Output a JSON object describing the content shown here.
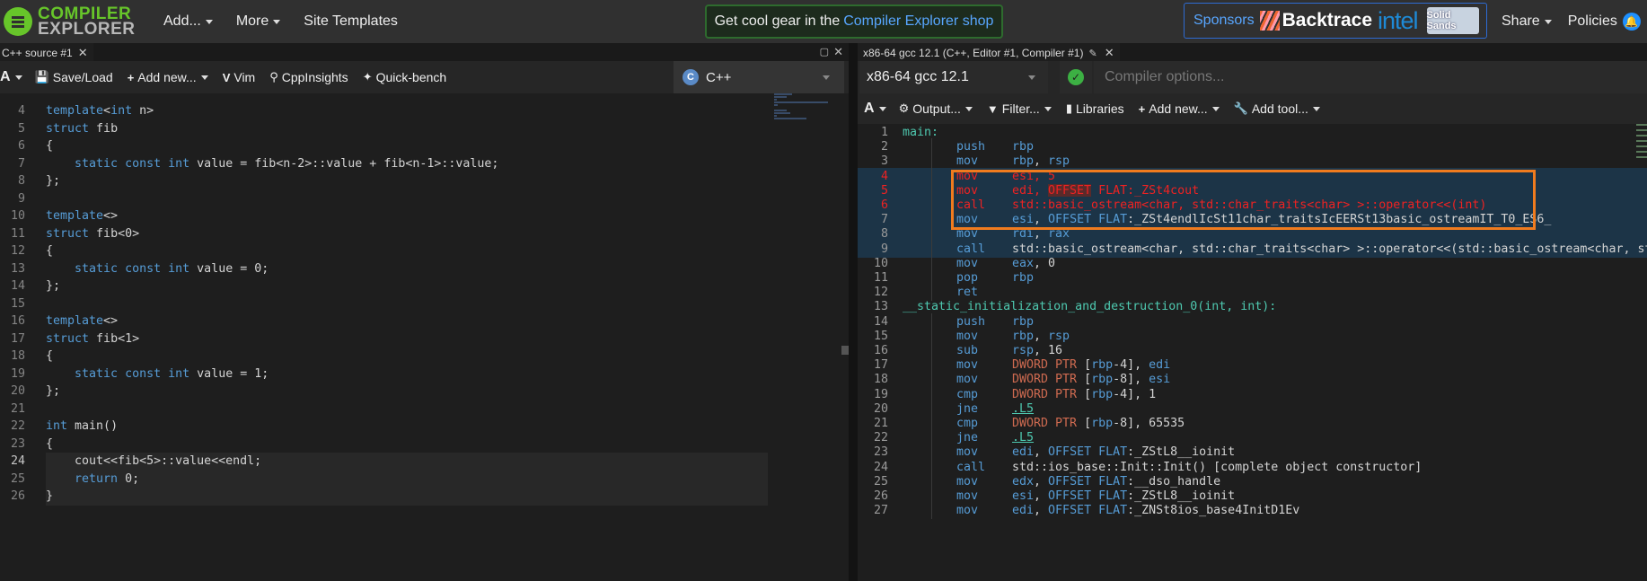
{
  "navbar": {
    "logo_line1": "COMPILER",
    "logo_line2": "EXPLORER",
    "menu": [
      {
        "label": "Add...",
        "dropdown": true
      },
      {
        "label": "More",
        "dropdown": true
      },
      {
        "label": "Site Templates",
        "dropdown": false
      }
    ],
    "shop_text": "Get cool gear in the",
    "shop_link": "Compiler Explorer shop",
    "sponsors_label": "Sponsors",
    "sponsor_backtrace": "Backtrace",
    "sponsor_intel": "intel",
    "sponsor_solid": "Solid Sands",
    "share": "Share",
    "policies": "Policies"
  },
  "source": {
    "tab_title": "C++ source #1",
    "toolbar": {
      "font": "A",
      "save_load": "Save/Load",
      "add_new": "Add new...",
      "vim": "Vim",
      "cppinsights": "CppInsights",
      "quickbench": "Quick-bench"
    },
    "language": "C++",
    "lines": [
      {
        "n": "4",
        "code": "template<int n>"
      },
      {
        "n": "5",
        "code": "struct fib"
      },
      {
        "n": "6",
        "code": "{"
      },
      {
        "n": "7",
        "code": "    static const int value = fib<n-2>::value + fib<n-1>::value;"
      },
      {
        "n": "8",
        "code": "};"
      },
      {
        "n": "9",
        "code": ""
      },
      {
        "n": "10",
        "code": "template<>"
      },
      {
        "n": "11",
        "code": "struct fib<0>"
      },
      {
        "n": "12",
        "code": "{"
      },
      {
        "n": "13",
        "code": "    static const int value = 0;"
      },
      {
        "n": "14",
        "code": "};"
      },
      {
        "n": "15",
        "code": ""
      },
      {
        "n": "16",
        "code": "template<>"
      },
      {
        "n": "17",
        "code": "struct fib<1>"
      },
      {
        "n": "18",
        "code": "{"
      },
      {
        "n": "19",
        "code": "    static const int value = 1;"
      },
      {
        "n": "20",
        "code": "};"
      },
      {
        "n": "21",
        "code": ""
      },
      {
        "n": "22",
        "code": "int main()"
      },
      {
        "n": "23",
        "code": "{"
      },
      {
        "n": "24",
        "code": "    cout<<fib<5>::value<<endl;"
      },
      {
        "n": "25",
        "code": "    return 0;"
      },
      {
        "n": "26",
        "code": "}"
      }
    ]
  },
  "compiler": {
    "tab_title": "x86-64 gcc 12.1 (C++, Editor #1, Compiler #1)",
    "name": "x86-64 gcc 12.1",
    "options_placeholder": "Compiler options...",
    "toolbar": {
      "font": "A",
      "output": "Output...",
      "filter": "Filter...",
      "libraries": "Libraries",
      "add_new": "Add new...",
      "add_tool": "Add tool..."
    },
    "asm": [
      {
        "n": "1",
        "label": "main:"
      },
      {
        "n": "2",
        "mn": "push",
        "op": "rbp"
      },
      {
        "n": "3",
        "mn": "mov",
        "op": "rbp, rsp"
      },
      {
        "n": "4",
        "mn": "mov",
        "op": "esi, 5",
        "hl": true,
        "red": true
      },
      {
        "n": "5",
        "mn": "mov",
        "op": "edi, OFFSET FLAT:_ZSt4cout",
        "hl": true,
        "red": true
      },
      {
        "n": "6",
        "mn": "call",
        "op": "std::basic_ostream<char, std::char_traits<char> >::operator<<(int)",
        "hl": true,
        "red": true
      },
      {
        "n": "7",
        "mn": "mov",
        "op": "esi, OFFSET FLAT:_ZSt4endlIcSt11char_traitsIcEERSt13basic_ostreamIT_T0_ES6_",
        "hl": true
      },
      {
        "n": "8",
        "mn": "mov",
        "op": "rdi, rax",
        "hl": true
      },
      {
        "n": "9",
        "mn": "call",
        "op": "std::basic_ostream<char, std::char_traits<char> >::operator<<(std::basic_ostream<char, st",
        "hl": true
      },
      {
        "n": "10",
        "mn": "mov",
        "op": "eax, 0"
      },
      {
        "n": "11",
        "mn": "pop",
        "op": "rbp"
      },
      {
        "n": "12",
        "mn": "ret",
        "op": ""
      },
      {
        "n": "13",
        "label": "__static_initialization_and_destruction_0(int, int):"
      },
      {
        "n": "14",
        "mn": "push",
        "op": "rbp"
      },
      {
        "n": "15",
        "mn": "mov",
        "op": "rbp, rsp"
      },
      {
        "n": "16",
        "mn": "sub",
        "op": "rsp, 16"
      },
      {
        "n": "17",
        "mn": "mov",
        "op": "DWORD PTR [rbp-4], edi"
      },
      {
        "n": "18",
        "mn": "mov",
        "op": "DWORD PTR [rbp-8], esi"
      },
      {
        "n": "19",
        "mn": "cmp",
        "op": "DWORD PTR [rbp-4], 1"
      },
      {
        "n": "20",
        "mn": "jne",
        "op": ".L5"
      },
      {
        "n": "21",
        "mn": "cmp",
        "op": "DWORD PTR [rbp-8], 65535"
      },
      {
        "n": "22",
        "mn": "jne",
        "op": ".L5"
      },
      {
        "n": "23",
        "mn": "mov",
        "op": "edi, OFFSET FLAT:_ZStL8__ioinit"
      },
      {
        "n": "24",
        "mn": "call",
        "op": "std::ios_base::Init::Init() [complete object constructor]"
      },
      {
        "n": "25",
        "mn": "mov",
        "op": "edx, OFFSET FLAT:__dso_handle"
      },
      {
        "n": "26",
        "mn": "mov",
        "op": "esi, OFFSET FLAT:_ZStL8__ioinit"
      },
      {
        "n": "27",
        "mn": "mov",
        "op": "edi, OFFSET FLAT:_ZNSt8ios_base4InitD1Ev"
      }
    ]
  },
  "colors": {
    "brand_green": "#67c52a",
    "annotation": "#f07b1e",
    "highlight_red": "#ee2222"
  }
}
